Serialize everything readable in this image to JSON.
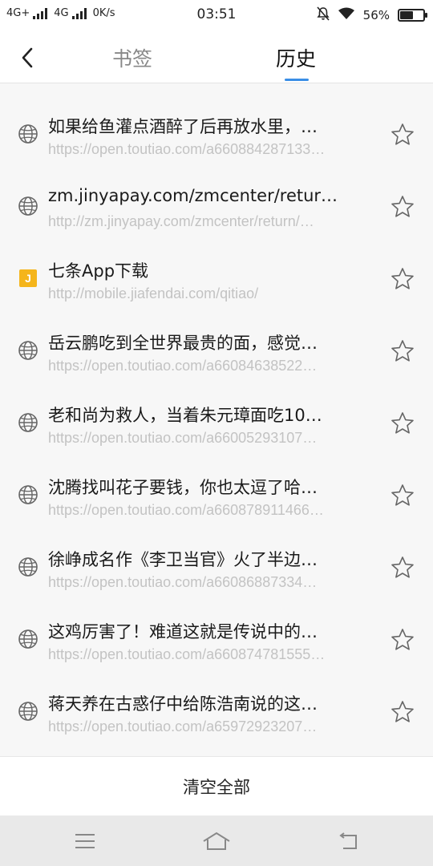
{
  "status_bar": {
    "network1": "4G+",
    "network2": "4G",
    "speed": "0K/s",
    "time": "03:51",
    "battery_percent": "56%",
    "battery_level": 0.56
  },
  "header": {
    "tabs": [
      {
        "label": "书签",
        "active": false
      },
      {
        "label": "历史",
        "active": true
      }
    ],
    "accent_color": "#3a8ee6"
  },
  "history": [
    {
      "icon": "globe-icon",
      "title": "如果给鱼灌点酒醉了后再放水里，…",
      "url": "https://open.toutiao.com/a660884287133…"
    },
    {
      "icon": "globe-icon",
      "title": "zm.jinyapay.com/zmcenter/retur…",
      "url": "http://zm.jinyapay.com/zmcenter/return/…"
    },
    {
      "icon": "qitiao-favicon",
      "favicon_letter": "J",
      "title": "七条App下载",
      "url": "http://mobile.jiafendai.com/qitiao/"
    },
    {
      "icon": "globe-icon",
      "title": "岳云鹏吃到全世界最贵的面，感觉…",
      "url": "https://open.toutiao.com/a66084638522…"
    },
    {
      "icon": "globe-icon",
      "title": "老和尚为救人，当着朱元璋面吃10…",
      "url": "https://open.toutiao.com/a66005293107…"
    },
    {
      "icon": "globe-icon",
      "title": "沈腾找叫花子要钱，你也太逗了哈…",
      "url": "https://open.toutiao.com/a660878911466…"
    },
    {
      "icon": "globe-icon",
      "title": "徐峥成名作《李卫当官》火了半边…",
      "url": "https://open.toutiao.com/a66086887334…"
    },
    {
      "icon": "globe-icon",
      "title": "这鸡厉害了！难道这就是传说中的…",
      "url": "https://open.toutiao.com/a660874781555…"
    },
    {
      "icon": "globe-icon",
      "title": "蒋天养在古惑仔中给陈浩南说的这…",
      "url": "https://open.toutiao.com/a65972923207…"
    }
  ],
  "footer": {
    "clear_all_label": "清空全部"
  },
  "nav_bar": {
    "buttons": [
      "menu-icon",
      "home-icon",
      "back-icon"
    ]
  }
}
